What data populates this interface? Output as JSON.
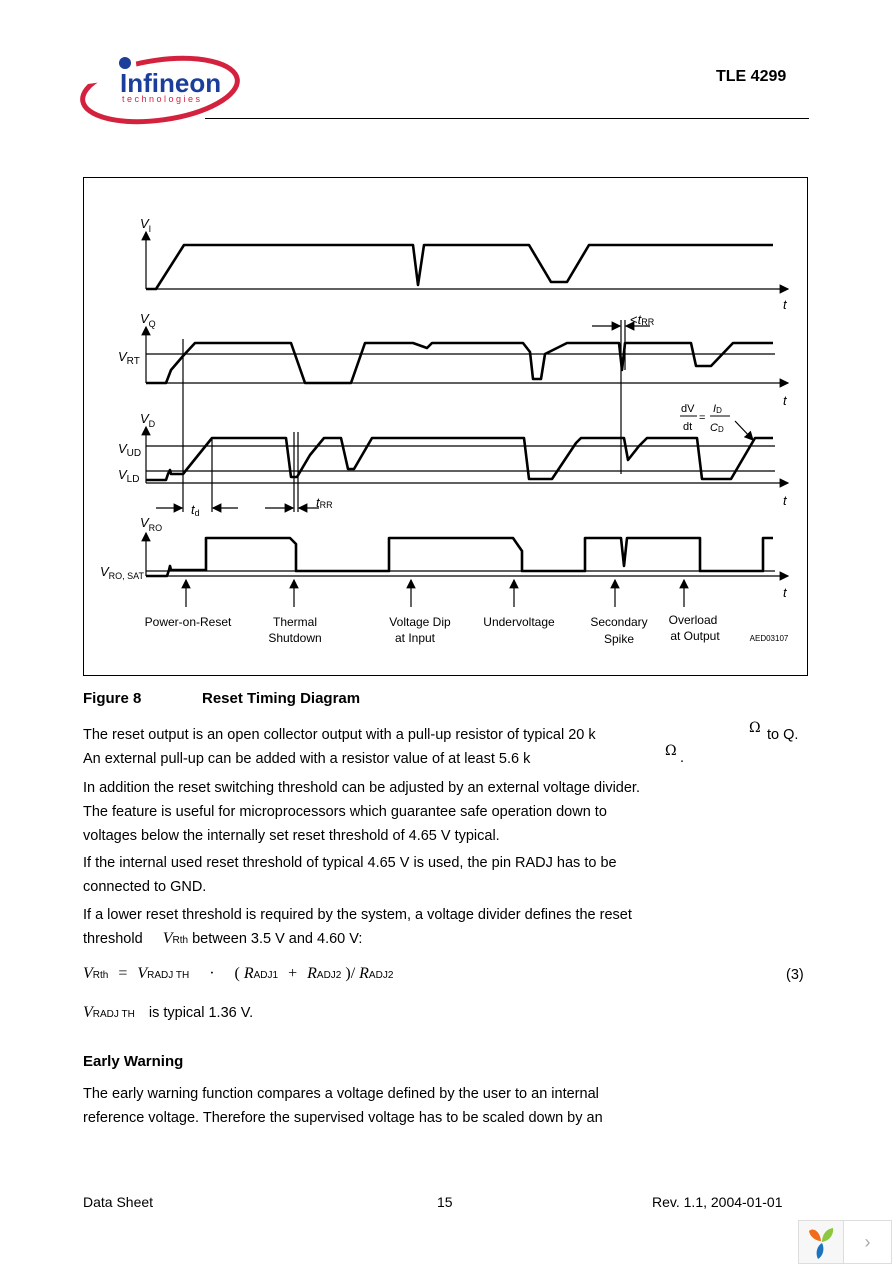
{
  "header": {
    "brand_name": "Infineon",
    "brand_sub": "technologies",
    "doc_title_prefix": "TLE",
    "doc_title_number": "4299"
  },
  "figure": {
    "label": "Figure 8",
    "title": "Reset Timing Diagram",
    "code": "AED03107",
    "signals": {
      "vi": "V",
      "vi_sub": "I",
      "vq": "V",
      "vq_sub": "Q",
      "vrt": "V",
      "vrt_sub": "RT",
      "vd": "V",
      "vd_sub": "D",
      "vud": "V",
      "vud_sub": "UD",
      "vld": "V",
      "vld_sub": "LD",
      "vro": "V",
      "vro_sub": "RO",
      "vrosat": "V",
      "vrosat_sub": "RO, SAT",
      "t_axis": "t",
      "td": "t",
      "td_sub": "d",
      "trr": "t",
      "trr_sub": "RR",
      "lt_trr_prefix": "<",
      "dv": "dV",
      "dt": "dt",
      "eq": "=",
      "id": "I",
      "id_sub": "D",
      "cd": "C",
      "cd_sub": "D"
    },
    "events": [
      {
        "line1": "Power-on-Reset",
        "line2": ""
      },
      {
        "line1": "Thermal",
        "line2": "Shutdown"
      },
      {
        "line1": "Voltage Dip",
        "line2": "at Input"
      },
      {
        "line1": "Undervoltage",
        "line2": ""
      },
      {
        "line1": "Secondary",
        "line2": "Spike"
      },
      {
        "line1": "Overload",
        "line2": "at Output"
      }
    ]
  },
  "body": {
    "p1a": "The reset output is an open collector output with a pull-up resistor of typical 20 k",
    "p1a_tail": "to Q.",
    "p1b": "An external pull-up can be added with a resistor value of at least 5.6 k",
    "p1b_tail": ".",
    "omega": "Ω",
    "p2_l1": "In addition the reset switching threshold can be adjusted by an external voltage divider.",
    "p2_l2": "The feature is useful for microprocessors which guarantee safe operation down to",
    "p2_l3": "voltages below the internally set reset threshold of 4.65 V typical.",
    "p3_l1": "If the internal used reset threshold of typical 4.65 V is used, the pin RADJ has to be",
    "p3_l2": "connected to GND.",
    "p4_l1": "If a lower reset threshold is required by the system, a voltage divider defines the reset",
    "p4_l2_a": "threshold",
    "p4_l2_b": "between 3.5 V and 4.60 V:",
    "equation": {
      "lhs": "V",
      "lhs_sub": "Rth",
      "eq": "=",
      "v": "V",
      "v_sub": "RADJ TH",
      "dot": "·",
      "open": "(",
      "r1": "R",
      "r1_sub": "ADJ1",
      "plus": "+",
      "r2": "R",
      "r2_sub": "ADJ2",
      "close_div": ")/",
      "r3": "R",
      "r3_sub": "ADJ2",
      "number": "(3)"
    },
    "p5_v": "V",
    "p5_sub": "RADJ TH",
    "p5_text": "is typical 1.36 V.",
    "section_title": "Early Warning",
    "p6_l1": "The early warning function compares a voltage defined by the user to an internal",
    "p6_l2": "reference voltage. Therefore the supervised voltage has to be scaled down by an"
  },
  "footer": {
    "left": "Data Sheet",
    "center": "15",
    "right": "Rev. 1.1, 2004-01-01"
  },
  "nav": {
    "next_label": "›"
  }
}
